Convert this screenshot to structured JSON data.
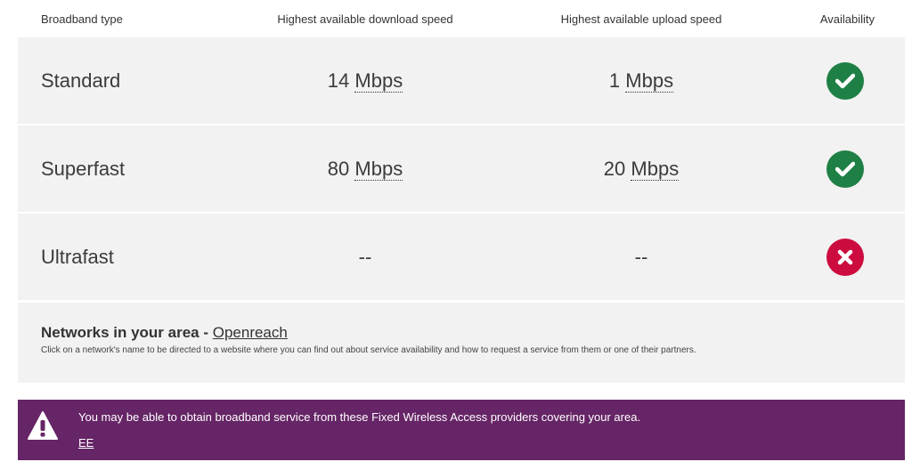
{
  "table": {
    "headers": {
      "type": "Broadband type",
      "download": "Highest available download speed",
      "upload": "Highest available upload speed",
      "availability": "Availability"
    },
    "rows": [
      {
        "type": "Standard",
        "download_value": "14",
        "download_unit": "Mbps",
        "upload_value": "1",
        "upload_unit": "Mbps",
        "available": true,
        "icon": "check-circle-icon"
      },
      {
        "type": "Superfast",
        "download_value": "80",
        "download_unit": "Mbps",
        "upload_value": "20",
        "upload_unit": "Mbps",
        "available": true,
        "icon": "check-circle-icon"
      },
      {
        "type": "Ultrafast",
        "download_value": "--",
        "download_unit": "",
        "upload_value": "--",
        "upload_unit": "",
        "available": false,
        "icon": "cross-circle-icon"
      }
    ]
  },
  "networks": {
    "title": "Networks in your area - ",
    "link": "Openreach",
    "note": "Click on a network's name to be directed to a website where you can find out about service availability and how to request a service from them or one of their partners."
  },
  "fwa": {
    "message": "You may be able to obtain broadband service from these Fixed Wireless Access providers covering your area.",
    "provider_link": "EE",
    "icon": "warning-triangle-icon"
  },
  "colors": {
    "row_bg": "#f2f2f2",
    "available": "#1e8044",
    "unavailable": "#cc0c3f",
    "banner_bg": "#662566"
  }
}
